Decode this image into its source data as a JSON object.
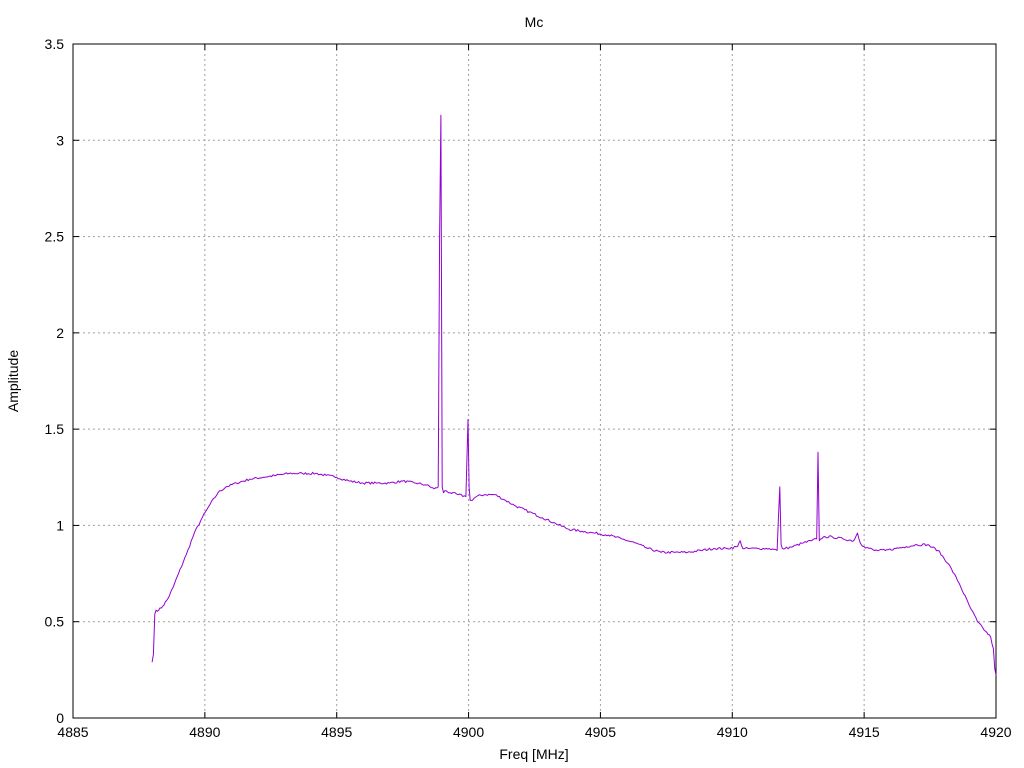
{
  "chart_data": {
    "type": "line",
    "title": "Mc",
    "xlabel": "Freq [MHz]",
    "ylabel": "Amplitude",
    "xlim": [
      4885,
      4920
    ],
    "ylim": [
      0,
      3.5
    ],
    "xticks": [
      4885,
      4890,
      4895,
      4900,
      4905,
      4910,
      4915,
      4920
    ],
    "xtick_labels": [
      "4885",
      "4890",
      "4895",
      "4900",
      "4905",
      "4910",
      "4915",
      "4920"
    ],
    "yticks": [
      0,
      0.5,
      1,
      1.5,
      2,
      2.5,
      3,
      3.5
    ],
    "ytick_labels": [
      "0",
      "0.5",
      "1",
      "1.5",
      "2",
      "2.5",
      "3",
      "3.5"
    ],
    "grid": true,
    "legend": "none",
    "series": [
      {
        "color": "#9400d3",
        "x": [
          4888.0,
          4888.05,
          4888.1,
          4888.15,
          4888.25,
          4888.4,
          4888.6,
          4888.8,
          4889.0,
          4889.3,
          4889.6,
          4889.9,
          4890.2,
          4890.5,
          4890.8,
          4891.2,
          4891.7,
          4892.2,
          4892.7,
          4893.2,
          4893.7,
          4894.2,
          4894.6,
          4895.0,
          4895.5,
          4896.0,
          4896.5,
          4897.0,
          4897.5,
          4898.0,
          4898.4,
          4898.7,
          4898.85,
          4898.9,
          4898.95,
          4899.0,
          4899.05,
          4899.1,
          4899.3,
          4899.6,
          4899.9,
          4899.98,
          4900.02,
          4900.06,
          4900.1,
          4900.3,
          4900.6,
          4901.0,
          4901.4,
          4901.8,
          4902.3,
          4902.8,
          4903.3,
          4903.8,
          4904.3,
          4904.8,
          4905.3,
          4905.8,
          4906.3,
          4906.8,
          4907.3,
          4907.8,
          4908.3,
          4908.8,
          4909.3,
          4909.8,
          4910.2,
          4910.3,
          4910.4,
          4910.6,
          4911.0,
          4911.4,
          4911.7,
          4911.8,
          4911.85,
          4911.9,
          4912.0,
          4912.3,
          4912.7,
          4913.0,
          4913.2,
          4913.25,
          4913.3,
          4913.35,
          4913.45,
          4913.8,
          4914.2,
          4914.6,
          4914.75,
          4914.85,
          4915.0,
          4915.4,
          4915.8,
          4916.2,
          4916.6,
          4917.0,
          4917.4,
          4917.8,
          4918.2,
          4918.6,
          4919.0,
          4919.3,
          4919.6,
          4919.8,
          4919.9,
          4919.95,
          4920.0
        ],
        "y": [
          0.29,
          0.33,
          0.54,
          0.56,
          0.56,
          0.58,
          0.62,
          0.68,
          0.75,
          0.85,
          0.96,
          1.04,
          1.11,
          1.17,
          1.2,
          1.22,
          1.24,
          1.25,
          1.26,
          1.27,
          1.27,
          1.27,
          1.26,
          1.25,
          1.23,
          1.22,
          1.22,
          1.22,
          1.23,
          1.22,
          1.21,
          1.19,
          1.2,
          2.5,
          3.13,
          1.2,
          1.17,
          1.18,
          1.17,
          1.16,
          1.15,
          1.55,
          1.2,
          1.13,
          1.13,
          1.15,
          1.16,
          1.16,
          1.13,
          1.1,
          1.07,
          1.04,
          1.01,
          0.98,
          0.97,
          0.96,
          0.95,
          0.93,
          0.91,
          0.88,
          0.86,
          0.86,
          0.86,
          0.87,
          0.88,
          0.88,
          0.89,
          0.92,
          0.88,
          0.88,
          0.88,
          0.88,
          0.87,
          1.2,
          0.9,
          0.88,
          0.88,
          0.89,
          0.91,
          0.92,
          0.93,
          1.38,
          0.92,
          0.93,
          0.94,
          0.94,
          0.93,
          0.92,
          0.96,
          0.91,
          0.89,
          0.87,
          0.87,
          0.88,
          0.89,
          0.9,
          0.9,
          0.87,
          0.8,
          0.7,
          0.58,
          0.5,
          0.45,
          0.42,
          0.36,
          0.26,
          0.22
        ]
      }
    ]
  }
}
